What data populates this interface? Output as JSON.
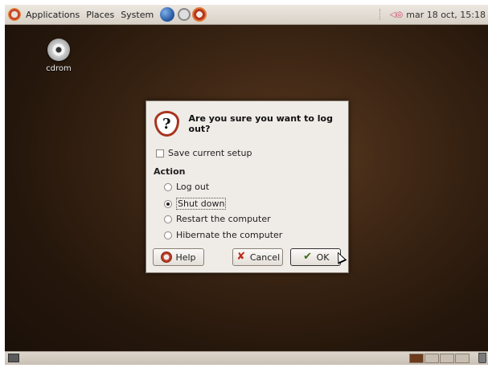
{
  "top_panel": {
    "menus": [
      "Applications",
      "Places",
      "System"
    ],
    "clock": "mar 18 oct, 15:18"
  },
  "desktop": {
    "icons": [
      {
        "label": "cdrom",
        "icon": "cdrom-icon"
      }
    ]
  },
  "dialog": {
    "title": "Are you sure you want to log out?",
    "save_setup_label": "Save current setup",
    "save_setup_checked": false,
    "action_label": "Action",
    "options": [
      {
        "label": "Log out",
        "checked": false
      },
      {
        "label": "Shut down",
        "checked": true
      },
      {
        "label": "Restart the computer",
        "checked": false
      },
      {
        "label": "Hibernate the computer",
        "checked": false
      }
    ],
    "buttons": {
      "help": "Help",
      "cancel": "Cancel",
      "ok": "OK"
    }
  }
}
